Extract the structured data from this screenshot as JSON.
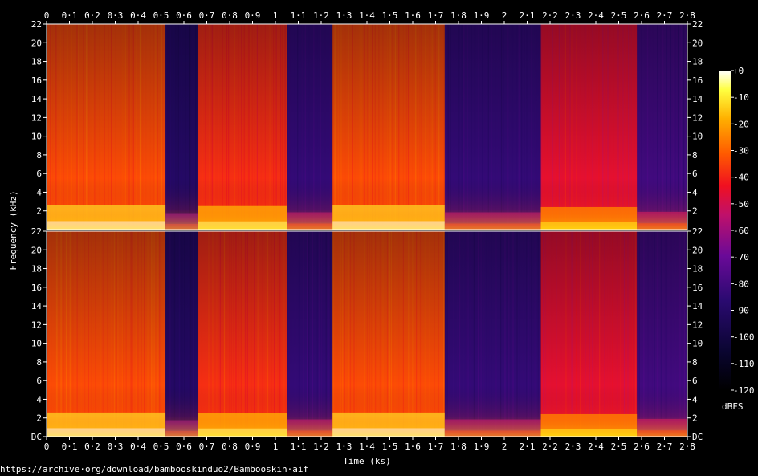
{
  "chart_data": {
    "type": "heatmap",
    "channels": 2,
    "xlabel": "Time (ks)",
    "ylabel": "Frequency (kHz)",
    "xlim": [
      0,
      2.8
    ],
    "ylim": [
      0,
      22
    ],
    "x_ticks": [
      "0",
      "0·1",
      "0·2",
      "0·3",
      "0·4",
      "0·5",
      "0·6",
      "0·7",
      "0·8",
      "0·9",
      "1",
      "1·1",
      "1·2",
      "1·3",
      "1·4",
      "1·5",
      "1·6",
      "1·7",
      "1·8",
      "1·9",
      "2",
      "2·1",
      "2·2",
      "2·3",
      "2·4",
      "2·5",
      "2·6",
      "2·7",
      "2·8"
    ],
    "y_ticks_top": [
      "22",
      "20",
      "18",
      "16",
      "14",
      "12",
      "10",
      "8",
      "6",
      "4",
      "2"
    ],
    "y_ticks_bottom": [
      "22",
      "20",
      "18",
      "16",
      "14",
      "12",
      "10",
      "8",
      "6",
      "4",
      "2",
      "DC"
    ],
    "colorbar": {
      "label": "dBFS",
      "range": [
        -120,
        0
      ],
      "ticks": [
        "+0",
        "-10",
        "-20",
        "-30",
        "-40",
        "-50",
        "-60",
        "-70",
        "-80",
        "-90",
        "-100",
        "-110",
        "-120"
      ]
    },
    "segments": [
      {
        "start": 0.0,
        "end": 0.52,
        "intensity": 0.72
      },
      {
        "start": 0.52,
        "end": 0.66,
        "intensity": 0.25
      },
      {
        "start": 0.66,
        "end": 1.05,
        "intensity": 0.68
      },
      {
        "start": 1.05,
        "end": 1.25,
        "intensity": 0.3
      },
      {
        "start": 1.25,
        "end": 1.74,
        "intensity": 0.72
      },
      {
        "start": 1.74,
        "end": 2.16,
        "intensity": 0.3
      },
      {
        "start": 2.16,
        "end": 2.58,
        "intensity": 0.62
      },
      {
        "start": 2.58,
        "end": 2.8,
        "intensity": 0.33
      }
    ]
  },
  "footer": {
    "source_url": "https://archive·org/download/bambooskinduo2/Bambooskin·aif"
  }
}
